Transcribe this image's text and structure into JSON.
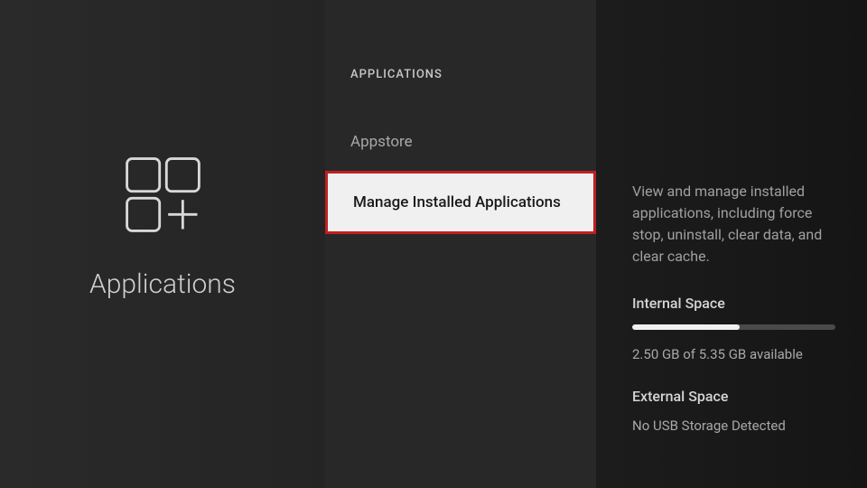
{
  "left": {
    "title": "Applications"
  },
  "middle": {
    "header": "APPLICATIONS",
    "items": [
      {
        "label": "Appstore"
      },
      {
        "label": "Manage Installed Applications"
      }
    ]
  },
  "right": {
    "description": "View and manage installed applications, including force stop, uninstall, clear data, and clear cache.",
    "internal": {
      "title": "Internal Space",
      "text": "2.50 GB of 5.35 GB available",
      "percent": 53
    },
    "external": {
      "title": "External Space",
      "text": "No USB Storage Detected"
    }
  }
}
